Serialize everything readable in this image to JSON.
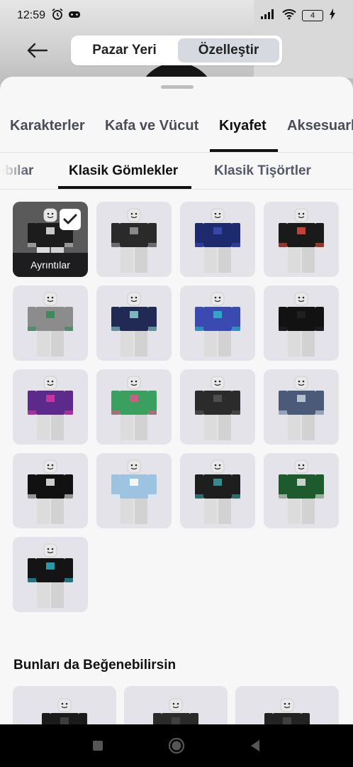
{
  "status": {
    "time": "12:59",
    "battery": "4"
  },
  "header": {
    "segments": [
      {
        "label": "Pazar Yeri",
        "active": false
      },
      {
        "label": "Özelleştir",
        "active": true
      }
    ]
  },
  "category_tabs": [
    {
      "label": "Karakterler",
      "active": false
    },
    {
      "label": "Kafa ve Vücut",
      "active": false
    },
    {
      "label": "Kıyafet",
      "active": true
    },
    {
      "label": "Aksesuarl",
      "active": false
    }
  ],
  "sub_tabs": [
    {
      "label": "ıbılar",
      "active": false
    },
    {
      "label": "Klasik Gömlekler",
      "active": true
    },
    {
      "label": "Klasik Tişörtler",
      "active": false
    }
  ],
  "selected_item": {
    "details_label": "Ayrıntılar"
  },
  "items": [
    {
      "shirt": "#1c1c1c",
      "accent": "#e8e8e8",
      "selected": true
    },
    {
      "shirt": "#2a2a2a",
      "accent": "#9a9a9a"
    },
    {
      "shirt": "#1e2a6e",
      "accent": "#3b4bb4"
    },
    {
      "shirt": "#1a1a1a",
      "accent": "#e24b3c"
    },
    {
      "shirt": "#8c8c8c",
      "accent": "#2e8b57"
    },
    {
      "shirt": "#202a55",
      "accent": "#8fd0d0"
    },
    {
      "shirt": "#3a4ab0",
      "accent": "#2fb8c8"
    },
    {
      "shirt": "#121212",
      "accent": "#222222"
    },
    {
      "shirt": "#5b2a8a",
      "accent": "#d43aa0"
    },
    {
      "shirt": "#3aa060",
      "accent": "#e2558b"
    },
    {
      "shirt": "#2b2b2b",
      "accent": "#555555"
    },
    {
      "shirt": "#4a5a78",
      "accent": "#c9d3e0"
    },
    {
      "shirt": "#111111",
      "accent": "#eeeeee"
    },
    {
      "shirt": "#9ec3e0",
      "accent": "#ffffff"
    },
    {
      "shirt": "#1e1e1e",
      "accent": "#3aa0a0"
    },
    {
      "shirt": "#1d5a2e",
      "accent": "#e8e8e8"
    },
    {
      "shirt": "#141414",
      "accent": "#2bb0c0"
    }
  ],
  "suggestions": {
    "title": "Bunları da Beğenebilirsin",
    "items": [
      {
        "shirt": "#1a1a1a"
      },
      {
        "shirt": "#2a2a2a"
      },
      {
        "shirt": "#222222"
      }
    ]
  }
}
